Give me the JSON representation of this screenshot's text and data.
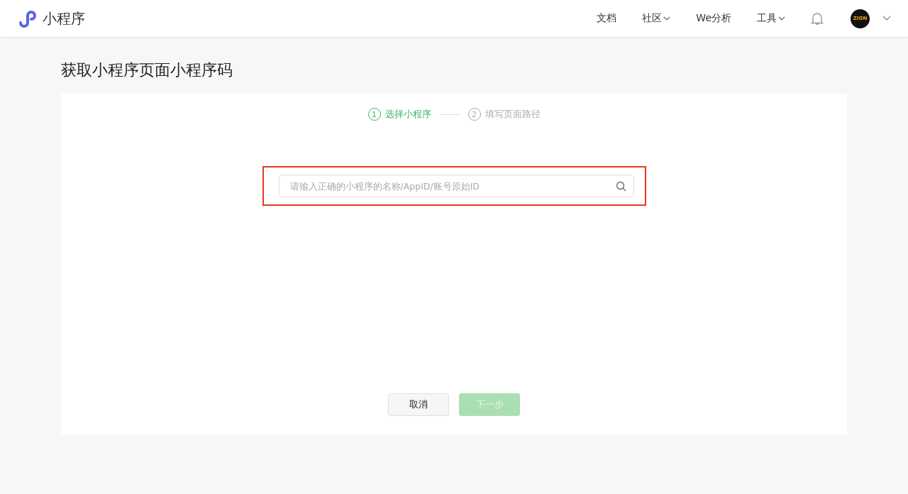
{
  "header": {
    "app_name": "小程序",
    "nav": [
      {
        "label": "文档",
        "dropdown": false
      },
      {
        "label": "社区",
        "dropdown": true
      },
      {
        "label": "We分析",
        "dropdown": false
      },
      {
        "label": "工具",
        "dropdown": true
      }
    ],
    "avatar": {
      "text": "ZION"
    }
  },
  "page_title": "获取小程序页面小程序码",
  "steps": [
    {
      "number": "1",
      "label": "选择小程序",
      "selected": true
    },
    {
      "number": "2",
      "label": "填写页面路径",
      "selected": false
    }
  ],
  "search": {
    "placeholder": "请输入正确的小程序的名称/AppID/账号原始ID",
    "highlighted": true
  },
  "buttons": [
    {
      "label": "取消",
      "disabled": false,
      "kind": "secondary"
    },
    {
      "label": "下一步",
      "disabled": true,
      "kind": "primary"
    }
  ]
}
